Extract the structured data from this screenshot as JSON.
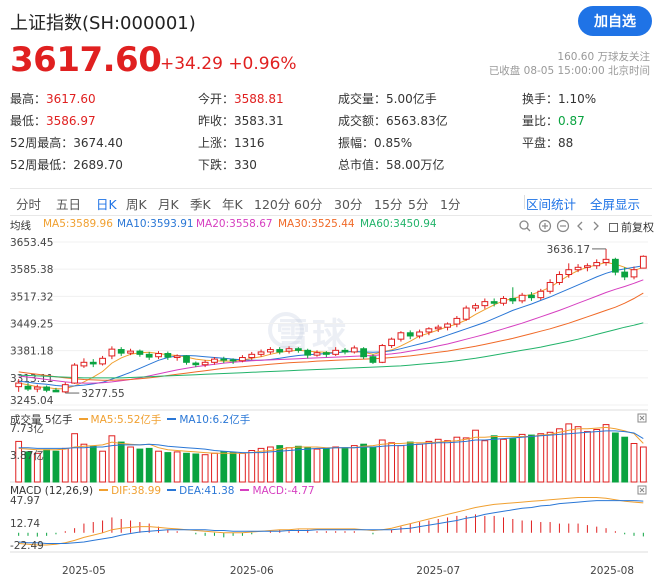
{
  "header": {
    "title": "上证指数(SH:000001)",
    "follow_label": "加自选"
  },
  "quote": {
    "price": "3617.60",
    "change": "+34.29 +0.96%",
    "followers": "160.60 万球友关注",
    "status": "已收盘 08-05 15:00:00 北京时间"
  },
  "stats": [
    {
      "label": "最高：",
      "value": "3617.60",
      "color": "red"
    },
    {
      "label": "今开：",
      "value": "3588.81",
      "color": "red"
    },
    {
      "label": "成交量：",
      "value": "5.00亿手",
      "color": "normal"
    },
    {
      "label": "换手：",
      "value": "1.10%",
      "color": "normal"
    },
    {
      "label": "最低：",
      "value": "3586.97",
      "color": "red"
    },
    {
      "label": "昨收：",
      "value": "3583.31",
      "color": "normal"
    },
    {
      "label": "成交额：",
      "value": "6563.83亿",
      "color": "normal"
    },
    {
      "label": "量比：",
      "value": "0.87",
      "color": "green"
    },
    {
      "label": "52周最高：",
      "value": "3674.40",
      "color": "normal"
    },
    {
      "label": "上涨：",
      "value": "1316",
      "color": "normal"
    },
    {
      "label": "振幅：",
      "value": "0.85%",
      "color": "normal"
    },
    {
      "label": "平盘：",
      "value": "88",
      "color": "normal"
    },
    {
      "label": "52周最低：",
      "value": "2689.70",
      "color": "normal"
    },
    {
      "label": "下跌：",
      "value": "330",
      "color": "normal"
    },
    {
      "label": "总市值：",
      "value": "58.00万亿",
      "color": "normal"
    }
  ],
  "tabs": [
    "分时",
    "五日",
    "日K",
    "周K",
    "月K",
    "季K",
    "年K",
    "120分",
    "60分",
    "30分",
    "15分",
    "5分",
    "1分"
  ],
  "active_tab": "日K",
  "tab_actions": [
    "区间统计",
    "全屏显示"
  ],
  "ma_legend": {
    "label": "均线",
    "items": [
      {
        "text": "MA5:3589.96",
        "color": "#f0a030"
      },
      {
        "text": "MA10:3593.91",
        "color": "#2a77d6"
      },
      {
        "text": "MA20:3558.67",
        "color": "#d63fc0"
      },
      {
        "text": "MA30:3525.44",
        "color": "#f06a28"
      },
      {
        "text": "MA60:3450.94",
        "color": "#22b36a"
      }
    ],
    "adjust": "前复权"
  },
  "volume_legend": {
    "label": "成交量 5亿手",
    "items": [
      {
        "text": "MA5:5.52亿手",
        "color": "#f0a030"
      },
      {
        "text": "MA10:6.2亿手",
        "color": "#2a77d6"
      }
    ],
    "ticks": [
      "7.73亿",
      "3.87亿"
    ]
  },
  "macd_legend": {
    "label": "MACD (12,26,9)",
    "items": [
      {
        "text": "DIF:38.99",
        "color": "#f0a030"
      },
      {
        "text": "DEA:41.38",
        "color": "#2a77d6"
      },
      {
        "text": "MACD:-4.77",
        "color": "#d63fc0"
      }
    ],
    "ticks": [
      "47.97",
      "12.74",
      "-22.49"
    ]
  },
  "watermark": "雪球",
  "colors": {
    "up": "#e02020",
    "down": "#0aa340",
    "accent": "#1f73e6"
  },
  "chart_data": {
    "type": "candlestick",
    "price_axis": {
      "ticks": [
        "3653.45",
        "3585.38",
        "3517.32",
        "3449.25",
        "3381.18",
        "3313.11",
        "3245.04"
      ],
      "ylim": [
        3245.04,
        3653.45
      ]
    },
    "x_ticks": [
      "2025-05",
      "2025-06",
      "2025-07",
      "2025-08"
    ],
    "annotations": {
      "high": "3636.17",
      "low": "3277.55"
    },
    "candles": [
      [
        3291,
        3300,
        3278,
        3310
      ],
      [
        3292,
        3285,
        3280,
        3300
      ],
      [
        3285,
        3290,
        3277,
        3296
      ],
      [
        3290,
        3282,
        3277,
        3294
      ],
      [
        3282,
        3278,
        3277.55,
        3288
      ],
      [
        3278,
        3296,
        3275,
        3302
      ],
      [
        3300,
        3345,
        3298,
        3350
      ],
      [
        3343,
        3352,
        3338,
        3362
      ],
      [
        3352,
        3348,
        3340,
        3360
      ],
      [
        3348,
        3362,
        3344,
        3368
      ],
      [
        3368,
        3385,
        3360,
        3392
      ],
      [
        3384,
        3375,
        3368,
        3390
      ],
      [
        3375,
        3380,
        3370,
        3386
      ],
      [
        3380,
        3372,
        3366,
        3384
      ],
      [
        3372,
        3365,
        3358,
        3378
      ],
      [
        3366,
        3374,
        3360,
        3380
      ],
      [
        3374,
        3365,
        3358,
        3379
      ],
      [
        3364,
        3368,
        3356,
        3372
      ],
      [
        3368,
        3352,
        3346,
        3370
      ],
      [
        3350,
        3346,
        3340,
        3354
      ],
      [
        3346,
        3352,
        3340,
        3358
      ],
      [
        3352,
        3360,
        3346,
        3365
      ],
      [
        3360,
        3358,
        3350,
        3366
      ],
      [
        3358,
        3356,
        3348,
        3362
      ],
      [
        3356,
        3364,
        3352,
        3370
      ],
      [
        3364,
        3372,
        3358,
        3378
      ],
      [
        3372,
        3378,
        3366,
        3384
      ],
      [
        3378,
        3384,
        3372,
        3390
      ],
      [
        3384,
        3378,
        3372,
        3390
      ],
      [
        3380,
        3386,
        3374,
        3392
      ],
      [
        3386,
        3382,
        3376,
        3390
      ],
      [
        3382,
        3370,
        3362,
        3386
      ],
      [
        3370,
        3376,
        3366,
        3382
      ],
      [
        3376,
        3372,
        3365,
        3380
      ],
      [
        3372,
        3382,
        3368,
        3390
      ],
      [
        3382,
        3378,
        3372,
        3388
      ],
      [
        3378,
        3388,
        3374,
        3394
      ],
      [
        3386,
        3366,
        3360,
        3390
      ],
      [
        3366,
        3352,
        3348,
        3372
      ],
      [
        3352,
        3394,
        3350,
        3398
      ],
      [
        3394,
        3410,
        3388,
        3414
      ],
      [
        3410,
        3426,
        3404,
        3430
      ],
      [
        3426,
        3418,
        3410,
        3432
      ],
      [
        3418,
        3428,
        3412,
        3434
      ],
      [
        3428,
        3436,
        3420,
        3440
      ],
      [
        3436,
        3440,
        3428,
        3446
      ],
      [
        3440,
        3448,
        3432,
        3452
      ],
      [
        3448,
        3462,
        3440,
        3468
      ],
      [
        3460,
        3488,
        3456,
        3494
      ],
      [
        3488,
        3494,
        3480,
        3500
      ],
      [
        3494,
        3504,
        3486,
        3512
      ],
      [
        3504,
        3500,
        3492,
        3512
      ],
      [
        3500,
        3512,
        3494,
        3518
      ],
      [
        3512,
        3506,
        3498,
        3540
      ],
      [
        3506,
        3520,
        3500,
        3526
      ],
      [
        3520,
        3514,
        3506,
        3528
      ],
      [
        3514,
        3530,
        3508,
        3536
      ],
      [
        3530,
        3552,
        3524,
        3560
      ],
      [
        3552,
        3572,
        3546,
        3580
      ],
      [
        3572,
        3584,
        3564,
        3600
      ],
      [
        3584,
        3590,
        3578,
        3598
      ],
      [
        3590,
        3594,
        3580,
        3600
      ],
      [
        3594,
        3602,
        3586,
        3610
      ],
      [
        3602,
        3610,
        3594,
        3636.17
      ],
      [
        3610,
        3578,
        3570,
        3614
      ],
      [
        3578,
        3566,
        3558,
        3590
      ],
      [
        3566,
        3584,
        3560,
        3592
      ],
      [
        3588,
        3617.6,
        3586.97,
        3620
      ]
    ],
    "ma_series": [
      {
        "name": "MA5",
        "values": [
          3300,
          3296,
          3291,
          3289,
          3286,
          3286,
          3293,
          3303,
          3315,
          3329,
          3350,
          3363,
          3372,
          3376,
          3377,
          3374,
          3371,
          3369,
          3365,
          3360,
          3357,
          3356,
          3355,
          3355,
          3357,
          3362,
          3366,
          3372,
          3377,
          3380,
          3382,
          3380,
          3378,
          3377,
          3376,
          3378,
          3379,
          3377,
          3372,
          3378,
          3383,
          3393,
          3405,
          3418,
          3425,
          3433,
          3441,
          3448,
          3458,
          3472,
          3484,
          3496,
          3506,
          3512,
          3518,
          3522,
          3530,
          3540,
          3555,
          3570,
          3582,
          3590,
          3596,
          3602,
          3598,
          3590,
          3582,
          3589.96
        ]
      },
      {
        "name": "MA10",
        "values": [
          3305,
          3302,
          3299,
          3297,
          3294,
          3292,
          3293,
          3295,
          3298,
          3302,
          3310,
          3318,
          3327,
          3337,
          3347,
          3357,
          3364,
          3368,
          3369,
          3368,
          3366,
          3364,
          3362,
          3360,
          3358,
          3357,
          3357,
          3359,
          3362,
          3366,
          3369,
          3371,
          3372,
          3374,
          3376,
          3378,
          3379,
          3378,
          3377,
          3378,
          3381,
          3386,
          3392,
          3398,
          3404,
          3412,
          3420,
          3428,
          3436,
          3444,
          3452,
          3462,
          3472,
          3482,
          3490,
          3498,
          3507,
          3516,
          3526,
          3536,
          3546,
          3556,
          3566,
          3575,
          3582,
          3586,
          3590,
          3593.91
        ]
      },
      {
        "name": "MA20",
        "values": [
          3318,
          3315,
          3312,
          3309,
          3306,
          3303,
          3301,
          3300,
          3300,
          3301,
          3303,
          3306,
          3309,
          3313,
          3318,
          3323,
          3328,
          3333,
          3337,
          3341,
          3344,
          3347,
          3350,
          3352,
          3354,
          3356,
          3357,
          3358,
          3359,
          3360,
          3361,
          3362,
          3363,
          3364,
          3365,
          3366,
          3367,
          3368,
          3369,
          3371,
          3373,
          3376,
          3380,
          3384,
          3388,
          3393,
          3398,
          3404,
          3410,
          3416,
          3422,
          3429,
          3436,
          3443,
          3450,
          3458,
          3466,
          3474,
          3482,
          3491,
          3500,
          3509,
          3518,
          3527,
          3535,
          3542,
          3550,
          3558.67
        ]
      },
      {
        "name": "MA30",
        "values": [
          3328,
          3325,
          3322,
          3319,
          3316,
          3313,
          3311,
          3309,
          3308,
          3307,
          3307,
          3308,
          3309,
          3311,
          3313,
          3316,
          3319,
          3322,
          3325,
          3328,
          3331,
          3334,
          3337,
          3339,
          3341,
          3343,
          3345,
          3347,
          3349,
          3351,
          3352,
          3353,
          3355,
          3356,
          3357,
          3358,
          3359,
          3360,
          3361,
          3362,
          3364,
          3366,
          3368,
          3371,
          3374,
          3377,
          3380,
          3384,
          3388,
          3392,
          3397,
          3402,
          3407,
          3412,
          3418,
          3424,
          3430,
          3436,
          3443,
          3450,
          3458,
          3466,
          3474,
          3482,
          3490,
          3500,
          3512,
          3525.44
        ]
      },
      {
        "name": "MA60",
        "values": [
          3320,
          3319,
          3318,
          3317,
          3316,
          3315,
          3314,
          3313,
          3313,
          3313,
          3313,
          3313,
          3314,
          3315,
          3316,
          3317,
          3318,
          3319,
          3320,
          3321,
          3322,
          3323,
          3324,
          3325,
          3326,
          3327,
          3328,
          3329,
          3330,
          3331,
          3332,
          3333,
          3334,
          3335,
          3336,
          3337,
          3338,
          3339,
          3340,
          3341,
          3342,
          3343,
          3345,
          3347,
          3349,
          3351,
          3353,
          3356,
          3359,
          3362,
          3366,
          3370,
          3374,
          3378,
          3382,
          3386,
          3390,
          3395,
          3400,
          3405,
          3410,
          3416,
          3422,
          3428,
          3434,
          3440,
          3445,
          3450.94
        ]
      }
    ],
    "volume": {
      "ylim": [
        0,
        8
      ],
      "values": [
        5.8,
        4.3,
        4.1,
        4.6,
        4.4,
        4.8,
        6.9,
        5.4,
        5.1,
        4.4,
        6.6,
        5.7,
        5.0,
        4.7,
        4.8,
        4.4,
        4.2,
        4.3,
        4.1,
        4.0,
        3.9,
        4.1,
        4.3,
        4.2,
        4.1,
        4.5,
        4.8,
        5.0,
        5.2,
        4.9,
        5.1,
        4.9,
        4.7,
        4.8,
        5.0,
        4.9,
        5.2,
        5.4,
        5.0,
        6.0,
        5.6,
        5.2,
        5.7,
        5.4,
        5.8,
        6.1,
        5.9,
        6.4,
        6.3,
        7.4,
        5.9,
        6.6,
        6.1,
        6.2,
        6.8,
        6.7,
        6.9,
        7.1,
        7.6,
        8.3,
        7.9,
        7.2,
        7.5,
        8.2,
        7.0,
        6.4,
        5.5,
        5.0
      ],
      "ma5": [
        4.8,
        4.7,
        4.6,
        4.6,
        4.6,
        4.7,
        5.0,
        5.1,
        5.2,
        5.3,
        5.7,
        5.5,
        5.4,
        5.3,
        5.4,
        4.9,
        4.6,
        4.5,
        4.4,
        4.3,
        4.2,
        4.1,
        4.1,
        4.1,
        4.1,
        4.2,
        4.4,
        4.5,
        4.7,
        4.9,
        5.0,
        5.0,
        5.0,
        4.9,
        4.9,
        4.9,
        4.9,
        5.1,
        5.2,
        5.4,
        5.5,
        5.5,
        5.6,
        5.6,
        5.6,
        5.7,
        5.8,
        5.9,
        6.1,
        6.4,
        6.4,
        6.5,
        6.5,
        6.5,
        6.5,
        6.5,
        6.7,
        6.8,
        7.1,
        7.4,
        7.6,
        7.6,
        7.7,
        7.8,
        7.6,
        7.3,
        6.9,
        5.52
      ],
      "ma10": [
        4.9,
        4.9,
        4.8,
        4.8,
        4.8,
        4.8,
        4.9,
        4.9,
        5.0,
        5.0,
        5.2,
        5.3,
        5.3,
        5.3,
        5.4,
        5.3,
        5.1,
        5.0,
        4.9,
        4.8,
        4.7,
        4.5,
        4.4,
        4.3,
        4.2,
        4.2,
        4.2,
        4.3,
        4.4,
        4.5,
        4.6,
        4.7,
        4.8,
        4.8,
        4.9,
        4.9,
        4.9,
        5.0,
        5.0,
        5.1,
        5.2,
        5.2,
        5.3,
        5.4,
        5.5,
        5.6,
        5.6,
        5.7,
        5.8,
        6.0,
        6.0,
        6.1,
        6.2,
        6.3,
        6.4,
        6.5,
        6.6,
        6.7,
        6.8,
        6.9,
        7.0,
        7.1,
        7.2,
        7.3,
        7.3,
        7.2,
        7.0,
        6.2
      ]
    },
    "macd": {
      "ylim": [
        -22.49,
        47.97
      ],
      "dif": [
        -14,
        -15,
        -16,
        -16,
        -15,
        -13,
        -10,
        -6,
        -3,
        0,
        4,
        6,
        7,
        8,
        8,
        7,
        6,
        5,
        4,
        3,
        2,
        1,
        0,
        0,
        0,
        1,
        2,
        3,
        4,
        4,
        5,
        5,
        5,
        5,
        5,
        5,
        5,
        4,
        3,
        4,
        6,
        9,
        12,
        15,
        18,
        21,
        24,
        27,
        30,
        33,
        35,
        37,
        38,
        39,
        40,
        41,
        42,
        43,
        44,
        45,
        46,
        46,
        46,
        45,
        43,
        41,
        40,
        38.99
      ],
      "dea": [
        -12,
        -13,
        -13,
        -14,
        -14,
        -14,
        -13,
        -12,
        -10,
        -8,
        -6,
        -3,
        -1,
        1,
        2,
        3,
        4,
        4,
        4,
        4,
        4,
        3,
        3,
        2,
        2,
        2,
        2,
        2,
        2,
        3,
        3,
        3,
        4,
        4,
        4,
        4,
        4,
        4,
        4,
        4,
        4,
        5,
        6,
        8,
        10,
        12,
        14,
        16,
        19,
        21,
        24,
        26,
        28,
        30,
        32,
        33,
        35,
        36,
        38,
        39,
        40,
        41,
        42,
        42,
        42,
        42,
        42,
        41.38
      ],
      "hist": [
        -4,
        -4,
        -5,
        -4,
        -2,
        2,
        6,
        12,
        14,
        16,
        20,
        18,
        16,
        14,
        12,
        8,
        4,
        2,
        0,
        -2,
        -4,
        -4,
        -6,
        -4,
        -4,
        -2,
        0,
        2,
        4,
        2,
        4,
        4,
        2,
        2,
        2,
        2,
        2,
        0,
        -2,
        0,
        4,
        8,
        12,
        14,
        16,
        18,
        20,
        22,
        22,
        24,
        22,
        22,
        20,
        18,
        16,
        16,
        14,
        14,
        12,
        12,
        12,
        10,
        8,
        6,
        2,
        -2,
        -4,
        -4.77
      ]
    }
  }
}
